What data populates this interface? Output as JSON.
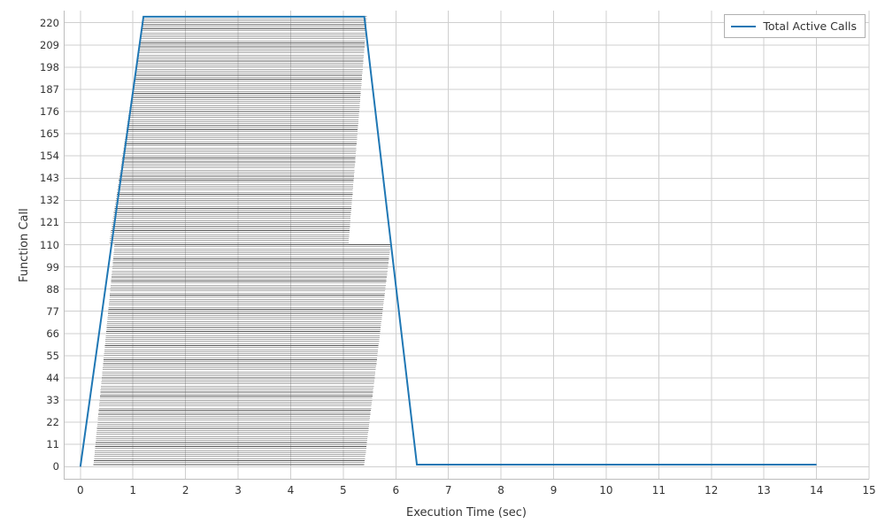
{
  "chart_data": {
    "type": "line",
    "title": "",
    "xlabel": "Execution Time (sec)",
    "ylabel": "Function Call",
    "xlim": [
      -0.3,
      15
    ],
    "ylim": [
      -6,
      226
    ],
    "x_ticks": [
      0,
      1,
      2,
      3,
      4,
      5,
      6,
      7,
      8,
      9,
      10,
      11,
      12,
      13,
      14,
      15
    ],
    "y_ticks": [
      0,
      11,
      22,
      33,
      44,
      55,
      66,
      77,
      88,
      99,
      110,
      121,
      132,
      143,
      154,
      165,
      176,
      187,
      198,
      209,
      220
    ],
    "series": [
      {
        "name": "Total Active Calls",
        "x": [
          0,
          1.2,
          5.4,
          6.4,
          14
        ],
        "y": [
          0,
          223,
          223,
          1,
          1
        ]
      }
    ],
    "legend": {
      "entries": [
        "Total Active Calls"
      ],
      "loc": "upper right"
    },
    "grid": true,
    "spans": {
      "n_calls": 223,
      "lower_block_count": 110,
      "upper_block_count": 113,
      "lower_start_range": [
        0.25,
        0.65
      ],
      "lower_end_range": [
        5.4,
        5.9
      ],
      "upper_start_range": [
        0.55,
        1.2
      ],
      "upper_end_range": [
        5.1,
        5.45
      ]
    }
  },
  "labels": {
    "xlabel": "Execution Time (sec)",
    "ylabel": "Function Call",
    "legend_entry": "Total Active Calls"
  },
  "colors": {
    "line": "#1f77b4",
    "grid": "#cfcfcf",
    "bars": "#555555"
  }
}
